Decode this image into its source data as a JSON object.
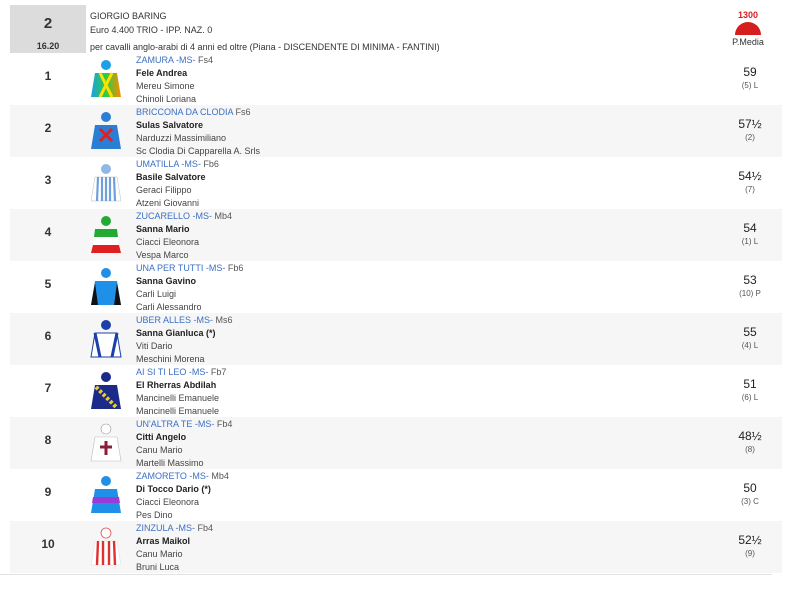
{
  "race": {
    "number": "2",
    "time": "16.20",
    "title": "GIORGIO BARING",
    "prize": "Euro 4.400 TRIO - IPP. NAZ. 0",
    "conditions": "per cavalli anglo-arabi di 4 anni ed oltre (Piana -  DISCENDENTE DI MINIMA  - FANTINI)",
    "distance": "1300",
    "track_label": "P.Media"
  },
  "colors": {
    "link": "#3b6fc4",
    "track_red": "#d61e1e",
    "alt_row": "#f6f6f6"
  },
  "runners": [
    {
      "num": "1",
      "horse": "ZAMURA",
      "horse_sfx": " -MS-",
      "age": " Fs4",
      "jockey": "Fele Andrea",
      "trainer": "Mereu Simone",
      "owner": "Chinoli Loriana",
      "weight": "59",
      "post": "(5) L",
      "silk": "silk-1-icon"
    },
    {
      "num": "2",
      "horse": "BRICCONA DA CLODIA",
      "horse_sfx": "",
      "age": " Fs6",
      "jockey": "Sulas Salvatore",
      "trainer": "Narduzzi Massimiliano",
      "owner": "Sc Clodia Di Capparella A. Srls",
      "weight": "57½",
      "post": "(2)",
      "silk": "silk-2-icon"
    },
    {
      "num": "3",
      "horse": "UMATILLA",
      "horse_sfx": " -MS-",
      "age": " Fb6",
      "jockey": "Basile Salvatore",
      "trainer": "Geraci Filippo",
      "owner": "Atzeni Giovanni",
      "weight": "54½",
      "post": "(7)",
      "silk": "silk-3-icon"
    },
    {
      "num": "4",
      "horse": "ZUCARELLO",
      "horse_sfx": " -MS-",
      "age": " Mb4",
      "jockey": "Sanna Mario",
      "trainer": "Ciacci Eleonora",
      "owner": "Vespa Marco",
      "weight": "54",
      "post": "(1) L",
      "silk": "silk-4-icon"
    },
    {
      "num": "5",
      "horse": "UNA PER TUTTI",
      "horse_sfx": " -MS-",
      "age": " Fb6",
      "jockey": "Sanna Gavino",
      "trainer": "Carli Luigi",
      "owner": "Carli Alessandro",
      "weight": "53",
      "post": "(10) P",
      "silk": "silk-5-icon"
    },
    {
      "num": "6",
      "horse": "UBER ALLES",
      "horse_sfx": " -MS-",
      "age": " Ms6",
      "jockey": "Sanna Gianluca (*)",
      "trainer": "Viti Dario",
      "owner": "Meschini Morena",
      "weight": "55",
      "post": "(4) L",
      "silk": "silk-6-icon"
    },
    {
      "num": "7",
      "horse": "AI SI TI LEO",
      "horse_sfx": " -MS-",
      "age": " Fb7",
      "jockey": "El Rherras Abdilah",
      "trainer": "Mancinelli Emanuele",
      "owner": "Mancinelli Emanuele",
      "weight": "51",
      "post": "(6) L",
      "silk": "silk-7-icon"
    },
    {
      "num": "8",
      "horse": "UN'ALTRA TE",
      "horse_sfx": " -MS-",
      "age": " Fb4",
      "jockey": "Citti Angelo",
      "trainer": "Canu Mario",
      "owner": "Martelli Massimo",
      "weight": "48½",
      "post": "(8)",
      "silk": "silk-8-icon"
    },
    {
      "num": "9",
      "horse": "ZAMORETO",
      "horse_sfx": " -MS-",
      "age": " Mb4",
      "jockey": "Di Tocco Dario (*)",
      "trainer": "Ciacci Eleonora",
      "owner": "Pes Dino",
      "weight": "50",
      "post": "(3) C",
      "silk": "silk-9-icon"
    },
    {
      "num": "10",
      "horse": "ZINZULA",
      "horse_sfx": " -MS-",
      "age": " Fb4",
      "jockey": "Arras Maikol",
      "trainer": "Canu Mario",
      "owner": "Bruni Luca",
      "weight": "52½",
      "post": "(9)",
      "silk": "silk-10-icon"
    }
  ]
}
